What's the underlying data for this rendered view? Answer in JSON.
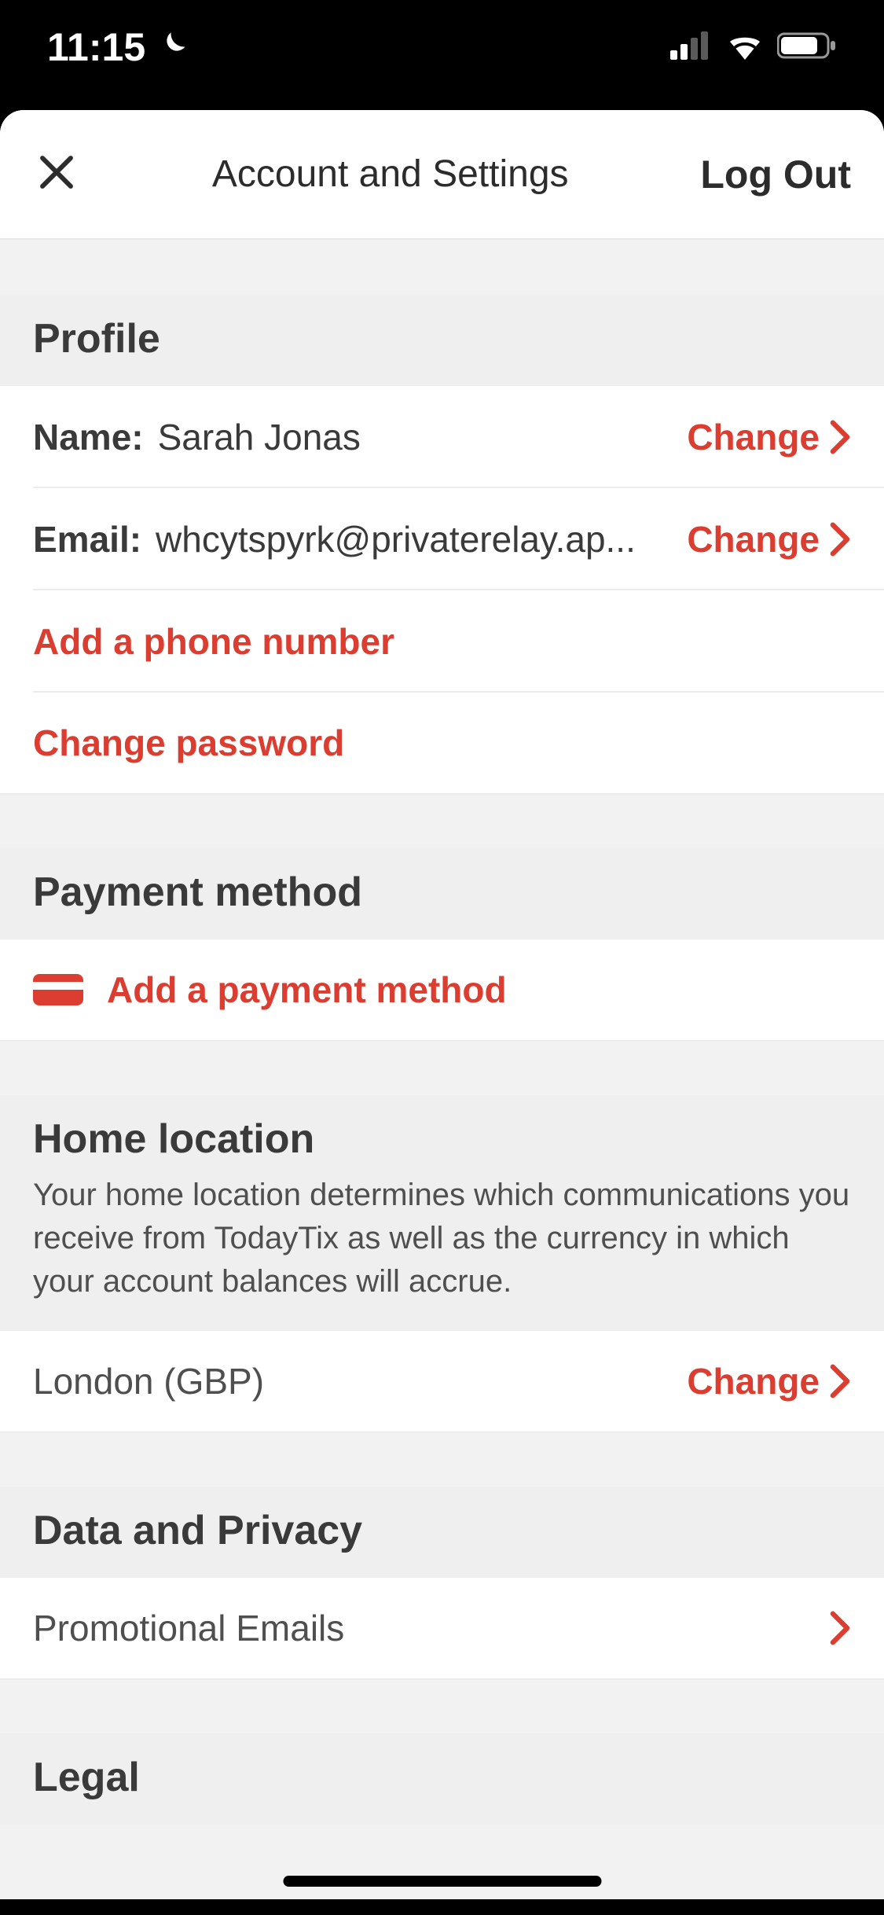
{
  "status": {
    "time": "11:15"
  },
  "nav": {
    "title": "Account and Settings",
    "logout": "Log Out"
  },
  "profile": {
    "header": "Profile",
    "name_label": "Name:",
    "name_value": "Sarah Jonas",
    "name_action": "Change",
    "email_label": "Email:",
    "email_value": "whcytspyrk@privaterelay.ap...",
    "email_action": "Change",
    "add_phone": "Add a phone number",
    "change_password": "Change password"
  },
  "payment": {
    "header": "Payment method",
    "add": "Add a payment method"
  },
  "home": {
    "header": "Home location",
    "desc": "Your home location determines which communications you receive from TodayTix as well as the currency in which your account balances will accrue.",
    "value": "London (GBP)",
    "action": "Change"
  },
  "privacy": {
    "header": "Data and Privacy",
    "promo": "Promotional Emails"
  },
  "legal": {
    "header": "Legal"
  },
  "colors": {
    "accent": "#db3d31"
  }
}
